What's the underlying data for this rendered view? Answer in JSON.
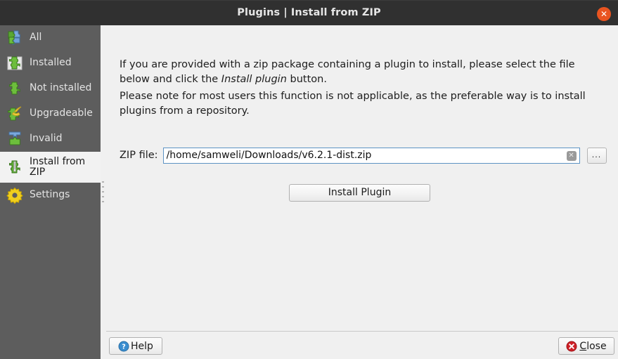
{
  "window": {
    "title": "Plugins | Install from ZIP",
    "close_icon": "close-icon",
    "accent_close": "#e95420",
    "sidebar_bg": "#5d5d5d",
    "content_bg": "#f0f0f0"
  },
  "sidebar": {
    "items": [
      {
        "label": "All",
        "icon": "puzzle-blue-green-icon",
        "selected": false
      },
      {
        "label": "Installed",
        "icon": "puzzle-installed-icon",
        "selected": false
      },
      {
        "label": "Not installed",
        "icon": "puzzle-green-icon",
        "selected": false
      },
      {
        "label": "Upgradeable",
        "icon": "puzzle-upgrade-icon",
        "selected": false
      },
      {
        "label": "Invalid",
        "icon": "puzzle-invalid-icon",
        "selected": false
      },
      {
        "label": "Install from ZIP",
        "icon": "puzzle-zip-icon",
        "selected": true
      },
      {
        "label": "Settings",
        "icon": "gear-icon",
        "selected": false
      }
    ]
  },
  "main": {
    "paragraph1_part1": "If you are provided with a zip package containing a plugin to install, please select the file below and click the ",
    "paragraph1_em": "Install plugin",
    "paragraph1_part2": " button.",
    "paragraph2": "Please note for most users this function is not applicable, as the preferable way is to install plugins from a repository.",
    "zip_label": "ZIP file:",
    "zip_value": "/home/samweli/Downloads/v6.2.1-dist.zip",
    "zip_placeholder": "",
    "clear_icon": "clear-field-icon",
    "browse_label": "...",
    "install_label": "Install Plugin"
  },
  "footer": {
    "help_label": "Help",
    "help_icon": "help-question-icon",
    "close_label_underlined": "C",
    "close_label_rest": "lose",
    "close_icon": "close-circle-icon"
  }
}
